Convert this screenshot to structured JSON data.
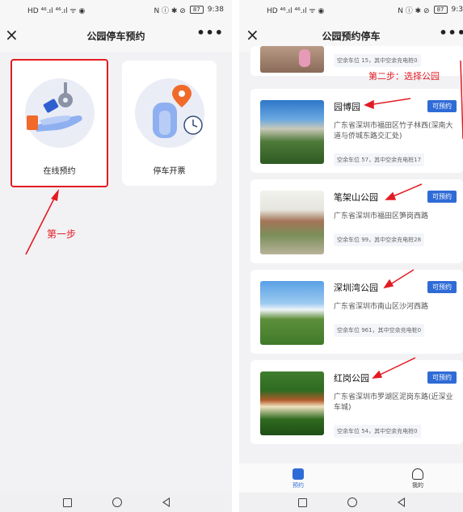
{
  "status_bar": {
    "left_icons": "HD ⁴⁶.ıl ⁴⁶.ıl ᯤ ◉",
    "right_icons": "N ⓘ ✱ ⊘",
    "battery": "87",
    "time": "9:38",
    "time_cut": "9:3"
  },
  "left_screen": {
    "title": "公园停车预约",
    "more": "•••",
    "close": "×",
    "cards": [
      {
        "label": "在线预约"
      },
      {
        "label": "停车开票"
      }
    ],
    "annotation": "第一步"
  },
  "right_screen": {
    "title": "公园预约停车",
    "more": "•••",
    "close": "×",
    "annotation": "第二步：选择公园",
    "top_partial": {
      "spots": "空余车位 15，其中空余充电桩0"
    },
    "parks": [
      {
        "name": "园博园",
        "button": "可预约",
        "address": "广东省深圳市福田区竹子林西(深南大道与侨城东路交汇处)",
        "spots": "空余车位 57，其中空余充电桩17"
      },
      {
        "name": "笔架山公园",
        "button": "可预约",
        "address": "广东省深圳市福田区笋岗西路",
        "spots": "空余车位 99，其中空余充电桩28"
      },
      {
        "name": "深圳湾公园",
        "button": "可预约",
        "address": "广东省深圳市南山区沙河西路",
        "spots": "空余车位 961，其中空余充电桩0"
      },
      {
        "name": "红岗公园",
        "button": "可预约",
        "address": "广东省深圳市罗湖区泥岗东路(近深业车城)",
        "spots": "空余车位 54，其中空余充电桩0"
      }
    ],
    "tabs": [
      {
        "label": "预约"
      },
      {
        "label": "我的"
      }
    ]
  },
  "colors": {
    "accent": "#2f6bd6",
    "annotation": "#e31b23",
    "highlight_border": "#e31b23"
  }
}
